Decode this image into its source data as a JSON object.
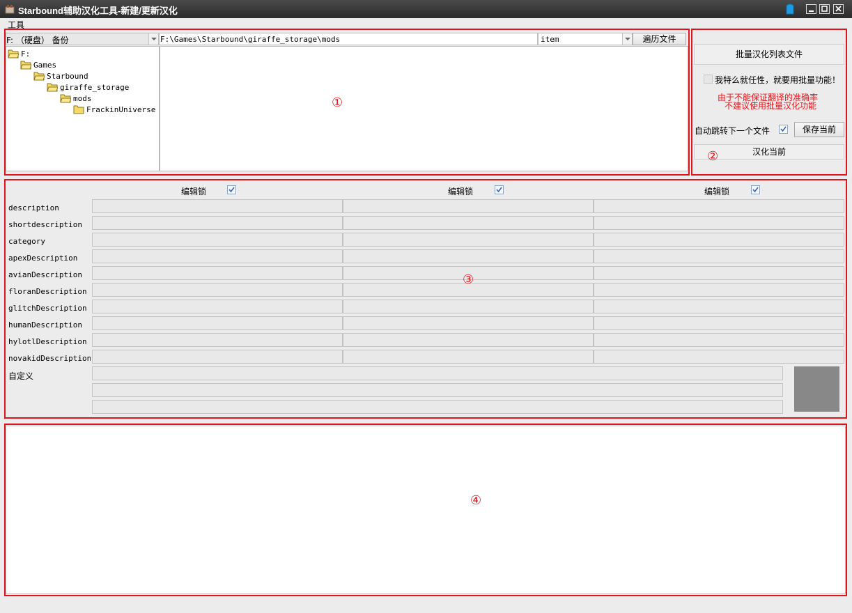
{
  "window": {
    "title": "Starbound辅助汉化工具-新建/更新汉化",
    "icons": [
      "app-icon",
      "skin-icon",
      "minimize-icon",
      "maximize-icon",
      "close-icon"
    ]
  },
  "menu": {
    "tools": "工具"
  },
  "browser": {
    "drive": "F: （硬盘） 备份",
    "path": "F:\\Games\\Starbound\\giraffe_storage\\mods",
    "filter": "item",
    "traverse_label": "遍历文件",
    "tree": [
      {
        "label": "F:",
        "level": 0
      },
      {
        "label": "Games",
        "level": 1
      },
      {
        "label": "Starbound",
        "level": 2
      },
      {
        "label": "giraffe_storage",
        "level": 3
      },
      {
        "label": "mods",
        "level": 4
      },
      {
        "label": "FrackinUniverse",
        "level": 5
      }
    ]
  },
  "batch": {
    "batch_list_label": "批量汉化列表文件",
    "willful_label": "我特么就任性，就要用批量功能！",
    "willful_checked": false,
    "warning_line1": "由于不能保证翻译的准确率",
    "warning_line2": "不建议使用批量汉化功能",
    "auto_next_label": "自动跳转下一个文件",
    "auto_next_checked": true,
    "save_current_label": "保存当前",
    "translate_current_label": "汉化当前"
  },
  "editor": {
    "lock_label": "编辑锁",
    "locks": [
      true,
      true,
      true
    ],
    "fields": [
      "description",
      "shortdescription",
      "category",
      "apexDescription",
      "avianDescription",
      "floranDescription",
      "glitchDescription",
      "humanDescription",
      "hylotlDescription",
      "novakidDescription"
    ],
    "custom_label": "自定义"
  },
  "annotations": [
    "①",
    "②",
    "③",
    "④"
  ],
  "colors": {
    "annotation": "#e0141a",
    "titlebar": "#2b2b2b",
    "background": "#ececec",
    "preview": "#888888"
  }
}
